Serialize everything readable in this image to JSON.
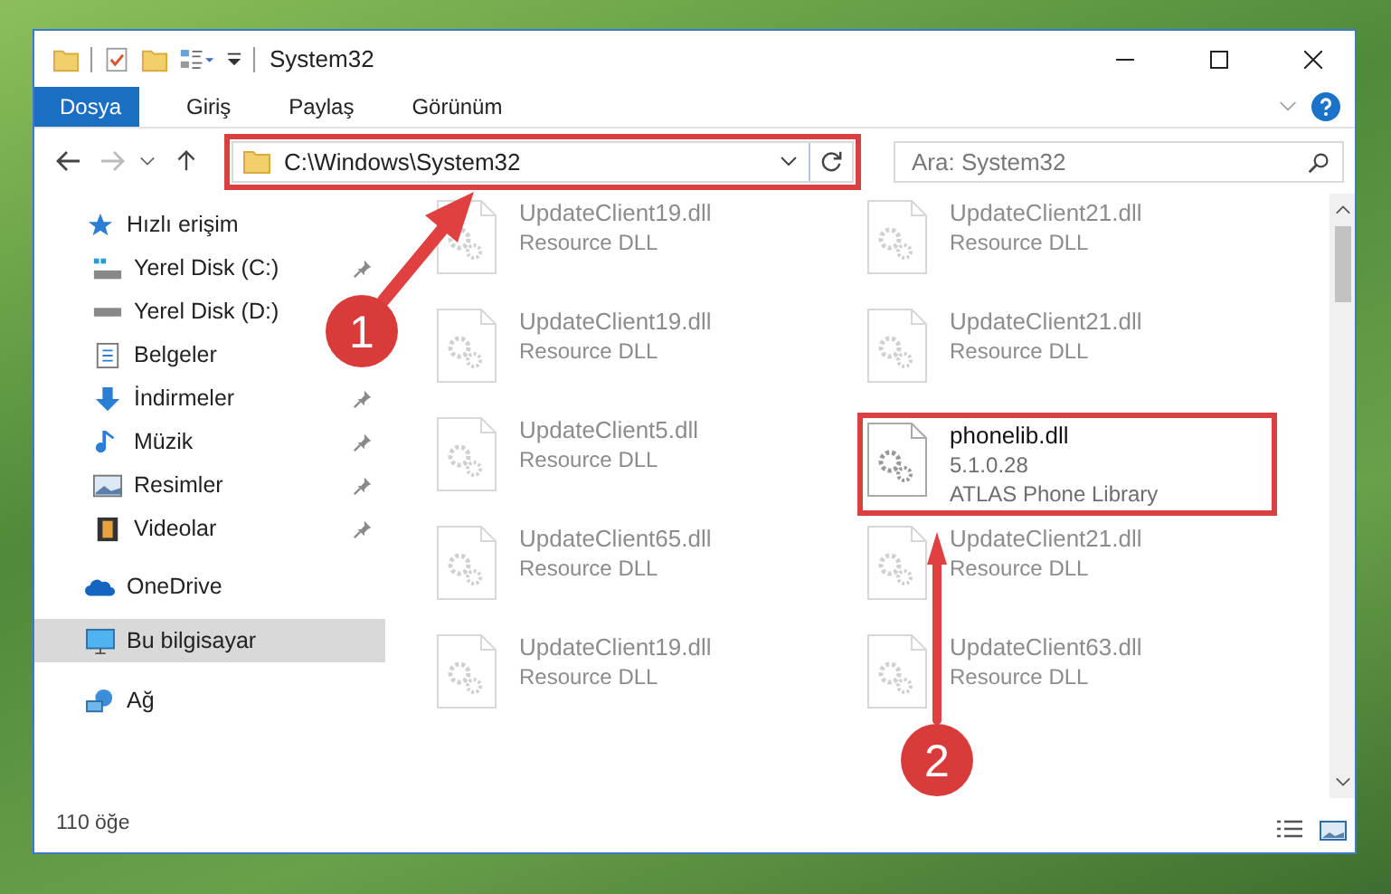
{
  "window": {
    "title": "System32"
  },
  "ribbon_tabs": [
    {
      "label": "Dosya",
      "selected": true
    },
    {
      "label": "Giriş",
      "selected": false
    },
    {
      "label": "Paylaş",
      "selected": false
    },
    {
      "label": "Görünüm",
      "selected": false
    }
  ],
  "address_bar": {
    "value": "C:\\Windows\\System32",
    "highlighted": true
  },
  "search": {
    "placeholder": "Ara: System32"
  },
  "sidebar": {
    "items": [
      {
        "label": "Hızlı erişim",
        "kind": "star",
        "selected": false,
        "children": [
          {
            "label": "Yerel Disk (C:)",
            "kind": "drive-c",
            "pinned": true,
            "selected": false
          },
          {
            "label": "Yerel Disk (D:)",
            "kind": "drive",
            "selected": false
          },
          {
            "label": "Belgeler",
            "kind": "document",
            "selected": false
          },
          {
            "label": "İndirmeler",
            "kind": "download",
            "pinned": true,
            "selected": false
          },
          {
            "label": "Müzik",
            "kind": "music",
            "pinned": true,
            "selected": false
          },
          {
            "label": "Resimler",
            "kind": "picture",
            "pinned": true,
            "selected": false
          },
          {
            "label": "Videolar",
            "kind": "video",
            "pinned": true,
            "selected": false
          }
        ]
      },
      {
        "label": "OneDrive",
        "kind": "cloud",
        "selected": false
      },
      {
        "label": "Bu bilgisayar",
        "kind": "computer",
        "selected": true
      },
      {
        "label": "Ağ",
        "kind": "network",
        "selected": false
      }
    ]
  },
  "files": [
    {
      "name": "UpdateClient19.dll",
      "lines": [
        "Resource DLL"
      ],
      "blurred": true,
      "highlighted": false
    },
    {
      "name": "UpdateClient21.dll",
      "lines": [
        "Resource DLL"
      ],
      "blurred": true,
      "highlighted": false
    },
    {
      "name": "UpdateClient19.dll",
      "lines": [
        "Resource DLL"
      ],
      "blurred": true,
      "highlighted": false
    },
    {
      "name": "UpdateClient21.dll",
      "lines": [
        "Resource DLL"
      ],
      "blurred": true,
      "highlighted": false
    },
    {
      "name": "UpdateClient5.dll",
      "lines": [
        "Resource DLL"
      ],
      "blurred": true,
      "highlighted": false
    },
    {
      "name": "phonelib.dll",
      "lines": [
        "5.1.0.28",
        "ATLAS Phone Library"
      ],
      "blurred": false,
      "highlighted": true
    },
    {
      "name": "UpdateClient65.dll",
      "lines": [
        "Resource DLL"
      ],
      "blurred": true,
      "highlighted": false
    },
    {
      "name": "UpdateClient21.dll",
      "lines": [
        "Resource DLL"
      ],
      "blurred": true,
      "highlighted": false
    },
    {
      "name": "UpdateClient19.dll",
      "lines": [
        "Resource DLL"
      ],
      "blurred": true,
      "highlighted": false
    },
    {
      "name": "UpdateClient63.dll",
      "lines": [
        "Resource DLL"
      ],
      "blurred": true,
      "highlighted": false
    }
  ],
  "status_bar": {
    "item_count": "110 öğe"
  },
  "annotations": [
    {
      "number": "1"
    },
    {
      "number": "2"
    }
  ]
}
